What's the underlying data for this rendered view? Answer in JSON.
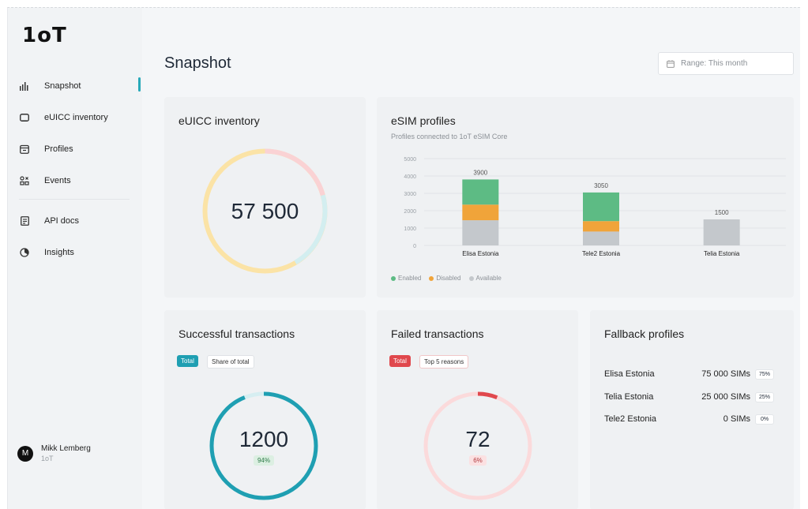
{
  "app": {
    "logo": "1oT"
  },
  "sidebar": {
    "items": [
      {
        "label": "Snapshot",
        "icon": "bar-chart-icon"
      },
      {
        "label": "eUICC inventory",
        "icon": "sim-card-icon"
      },
      {
        "label": "Profiles",
        "icon": "profiles-icon"
      },
      {
        "label": "Events",
        "icon": "events-icon"
      },
      {
        "label": "API docs",
        "icon": "document-icon"
      },
      {
        "label": "Insights",
        "icon": "pie-chart-icon"
      }
    ],
    "user": {
      "initial": "M",
      "name": "Mikk Lemberg",
      "org": "1oT"
    }
  },
  "header": {
    "title": "Snapshot",
    "range_label": "Range: This month"
  },
  "euicc": {
    "title": "eUICC inventory",
    "value": "57 500"
  },
  "esim": {
    "title": "eSIM profiles",
    "subtitle": "Profiles connected to 1oT eSIM Core",
    "legend": [
      "Enabled",
      "Disabled",
      "Available"
    ],
    "colors": {
      "enabled": "#5dbb84",
      "disabled": "#f0a43a",
      "available": "#c4c8cc"
    }
  },
  "chart_data": {
    "type": "bar",
    "stacked": true,
    "categories": [
      "Elisa Estonia",
      "Tele2 Estonia",
      "Telia Estonia"
    ],
    "series": [
      {
        "name": "Enabled",
        "values": [
          1450,
          1650,
          0
        ]
      },
      {
        "name": "Disabled",
        "values": [
          900,
          600,
          0
        ]
      },
      {
        "name": "Available",
        "values": [
          1450,
          800,
          1500
        ]
      }
    ],
    "totals": [
      "3900",
      "3050",
      "1500"
    ],
    "ylim": [
      0,
      5000
    ],
    "yticks": [
      "5000",
      "4000",
      "3000",
      "2000",
      "1000",
      "0"
    ],
    "grid": true,
    "legend_position": "bottom-left"
  },
  "successful": {
    "title": "Successful transactions",
    "tab_total": "Total",
    "tab_share": "Share of total",
    "value": "1200",
    "pct": "94%",
    "fraction": 0.94,
    "color": "#1f9fb2"
  },
  "failed": {
    "title": "Failed transactions",
    "tab_total": "Total",
    "tab_reasons": "Top 5 reasons",
    "value": "72",
    "pct": "6%",
    "fraction": 0.06,
    "color": "#e0484d"
  },
  "fallback": {
    "title": "Fallback profiles",
    "rows": [
      {
        "name": "Elisa Estonia",
        "value": "75 000 SIMs",
        "pct": "75%"
      },
      {
        "name": "Telia Estonia",
        "value": "25 000 SIMs",
        "pct": "25%"
      },
      {
        "name": "Tele2 Estonia",
        "value": "0 SIMs",
        "pct": "0%"
      }
    ]
  }
}
